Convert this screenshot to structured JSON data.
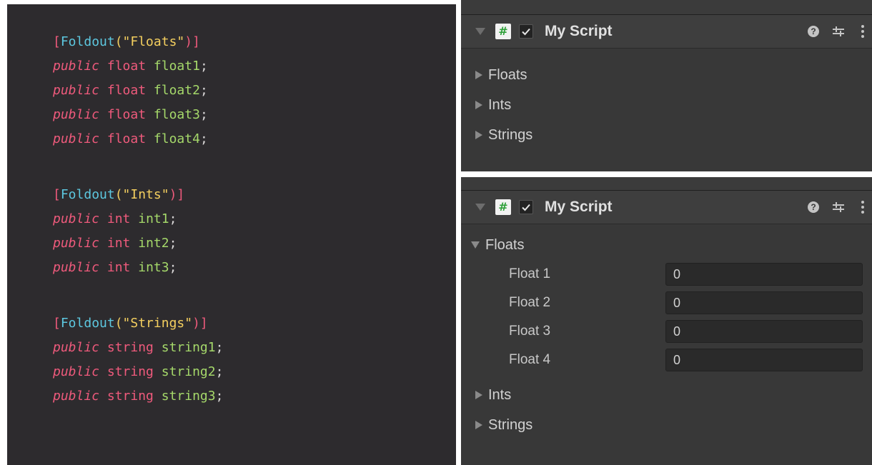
{
  "code": {
    "groups": [
      {
        "attr_open": "[",
        "attr_name": "Foldout",
        "attr_lparen": "(",
        "attr_string": "\"Floats\"",
        "attr_close": ")]",
        "fields": [
          {
            "kw": "public",
            "type": "float",
            "name": "float1",
            "semi": ";"
          },
          {
            "kw": "public",
            "type": "float",
            "name": "float2",
            "semi": ";"
          },
          {
            "kw": "public",
            "type": "float",
            "name": "float3",
            "semi": ";"
          },
          {
            "kw": "public",
            "type": "float",
            "name": "float4",
            "semi": ";"
          }
        ]
      },
      {
        "attr_open": "[",
        "attr_name": "Foldout",
        "attr_lparen": "(",
        "attr_string": "\"Ints\"",
        "attr_close": ")]",
        "fields": [
          {
            "kw": "public",
            "type": "int",
            "name": "int1",
            "semi": ";"
          },
          {
            "kw": "public",
            "type": "int",
            "name": "int2",
            "semi": ";"
          },
          {
            "kw": "public",
            "type": "int",
            "name": "int3",
            "semi": ";"
          }
        ]
      },
      {
        "attr_open": "[",
        "attr_name": "Foldout",
        "attr_lparen": "(",
        "attr_string": "\"Strings\"",
        "attr_close": ")]",
        "fields": [
          {
            "kw": "public",
            "type": "string",
            "name": "string1",
            "semi": ";"
          },
          {
            "kw": "public",
            "type": "string",
            "name": "string2",
            "semi": ";"
          },
          {
            "kw": "public",
            "type": "string",
            "name": "string3",
            "semi": ";"
          }
        ]
      }
    ]
  },
  "inspector_collapsed": {
    "title": "My Script",
    "enabled": true,
    "icons": [
      "script-icon",
      "help-icon",
      "preset-icon",
      "more-options-icon"
    ],
    "foldouts": [
      {
        "label": "Floats",
        "expanded": false
      },
      {
        "label": "Ints",
        "expanded": false
      },
      {
        "label": "Strings",
        "expanded": false
      }
    ]
  },
  "inspector_expanded": {
    "title": "My Script",
    "enabled": true,
    "icons": [
      "script-icon",
      "help-icon",
      "preset-icon",
      "more-options-icon"
    ],
    "floats_label": "Floats",
    "float_fields": [
      {
        "label": "Float 1",
        "value": "0"
      },
      {
        "label": "Float 2",
        "value": "0"
      },
      {
        "label": "Float 3",
        "value": "0"
      },
      {
        "label": "Float 4",
        "value": "0"
      }
    ],
    "ints_label": "Ints",
    "strings_label": "Strings"
  },
  "colors": {
    "code_bg": "#2d2b2e",
    "keyword": "#ef5a7c",
    "attribute": "#5dc8e0",
    "string": "#f4cf5f",
    "identifier": "#a5d86a",
    "inspector_bg": "#383838",
    "script_icon_hash": "#2fa13a"
  }
}
